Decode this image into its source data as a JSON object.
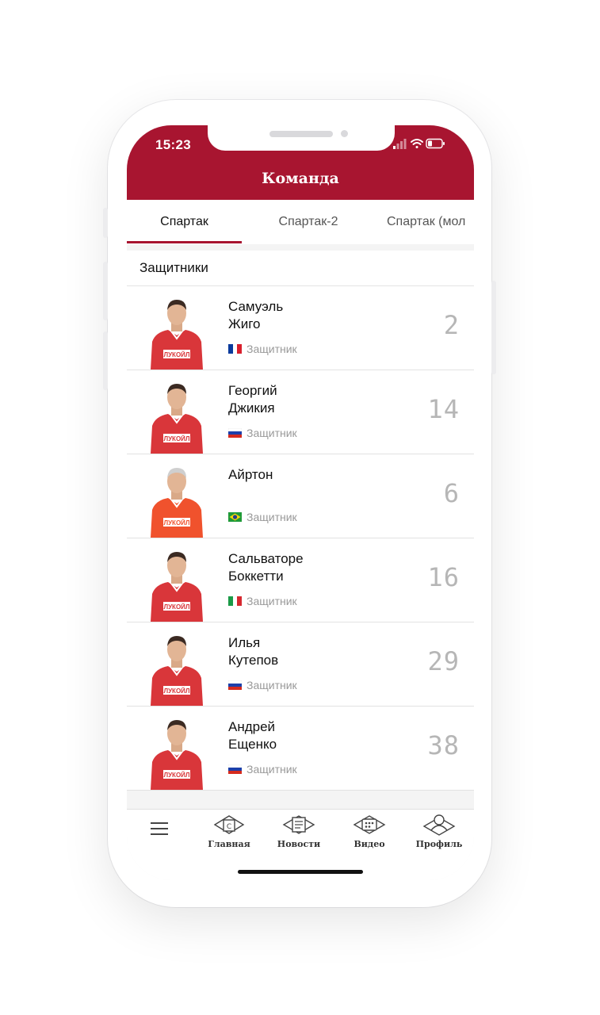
{
  "status_bar": {
    "time": "15:23"
  },
  "header": {
    "title": "Команда"
  },
  "tabs": [
    {
      "label": "Спартак",
      "active": true
    },
    {
      "label": "Спартак-2",
      "active": false
    },
    {
      "label": "Спартак (мол",
      "active": false
    }
  ],
  "section": {
    "title": "Защитники"
  },
  "players": [
    {
      "first_name": "Самуэль",
      "last_name": "Жиго",
      "position": "Защитник",
      "number": "2",
      "flag": "france",
      "kit": "red"
    },
    {
      "first_name": "Георгий",
      "last_name": "Джикия",
      "position": "Защитник",
      "number": "14",
      "flag": "russia",
      "kit": "red"
    },
    {
      "first_name": "Айртон",
      "last_name": "",
      "position": "Защитник",
      "number": "6",
      "flag": "brazil",
      "kit": "orange"
    },
    {
      "first_name": "Сальваторе",
      "last_name": "Боккетти",
      "position": "Защитник",
      "number": "16",
      "flag": "italy",
      "kit": "red"
    },
    {
      "first_name": "Илья",
      "last_name": "Кутепов",
      "position": "Защитник",
      "number": "29",
      "flag": "russia",
      "kit": "red"
    },
    {
      "first_name": "Андрей",
      "last_name": "Ещенко",
      "position": "Защитник",
      "number": "38",
      "flag": "russia",
      "kit": "red"
    }
  ],
  "photo_text": {
    "sponsor": "ЛУКОЙЛ"
  },
  "bottom_nav": {
    "menu_icon": "hamburger-icon",
    "items": [
      {
        "label": "Главная",
        "icon": "home-icon",
        "glyph": "С"
      },
      {
        "label": "Новости",
        "icon": "news-icon"
      },
      {
        "label": "Видео",
        "icon": "video-icon"
      },
      {
        "label": "Профиль",
        "icon": "profile-icon"
      }
    ]
  },
  "colors": {
    "brand": "#a81530",
    "number": "#b6b6b6",
    "kit_red": "#d9363a",
    "kit_orange": "#f0522d"
  }
}
